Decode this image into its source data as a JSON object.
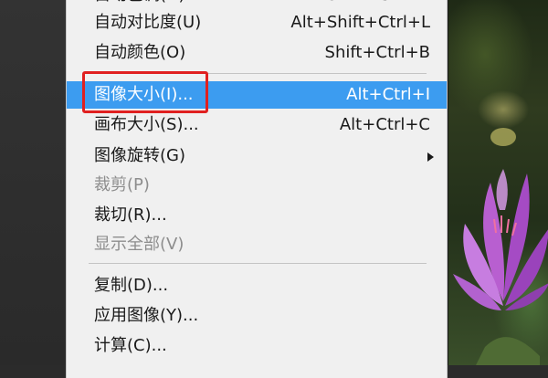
{
  "menu": {
    "items": [
      {
        "label": "自动色调(N)",
        "shortcut": "Shift+Ctrl+L",
        "state": "normal"
      },
      {
        "label": "自动对比度(U)",
        "shortcut": "Alt+Shift+Ctrl+L",
        "state": "normal"
      },
      {
        "label": "自动颜色(O)",
        "shortcut": "Shift+Ctrl+B",
        "state": "normal"
      },
      {
        "label": "图像大小(I)...",
        "shortcut": "Alt+Ctrl+I",
        "state": "highlighted"
      },
      {
        "label": "画布大小(S)...",
        "shortcut": "Alt+Ctrl+C",
        "state": "normal"
      },
      {
        "label": "图像旋转(G)",
        "shortcut": "",
        "state": "submenu"
      },
      {
        "label": "裁剪(P)",
        "shortcut": "",
        "state": "disabled"
      },
      {
        "label": "裁切(R)...",
        "shortcut": "",
        "state": "normal"
      },
      {
        "label": "显示全部(V)",
        "shortcut": "",
        "state": "disabled"
      },
      {
        "label": "复制(D)...",
        "shortcut": "",
        "state": "normal"
      },
      {
        "label": "应用图像(Y)...",
        "shortcut": "",
        "state": "normal"
      },
      {
        "label": "计算(C)...",
        "shortcut": "",
        "state": "normal"
      }
    ]
  },
  "colors": {
    "highlight": "#3c9cf0",
    "annotation_box": "#e02020",
    "menu_background": "#f0f0f0",
    "disabled_text": "#8d8d8d"
  },
  "icons": [
    "submenu-arrow-icon"
  ]
}
